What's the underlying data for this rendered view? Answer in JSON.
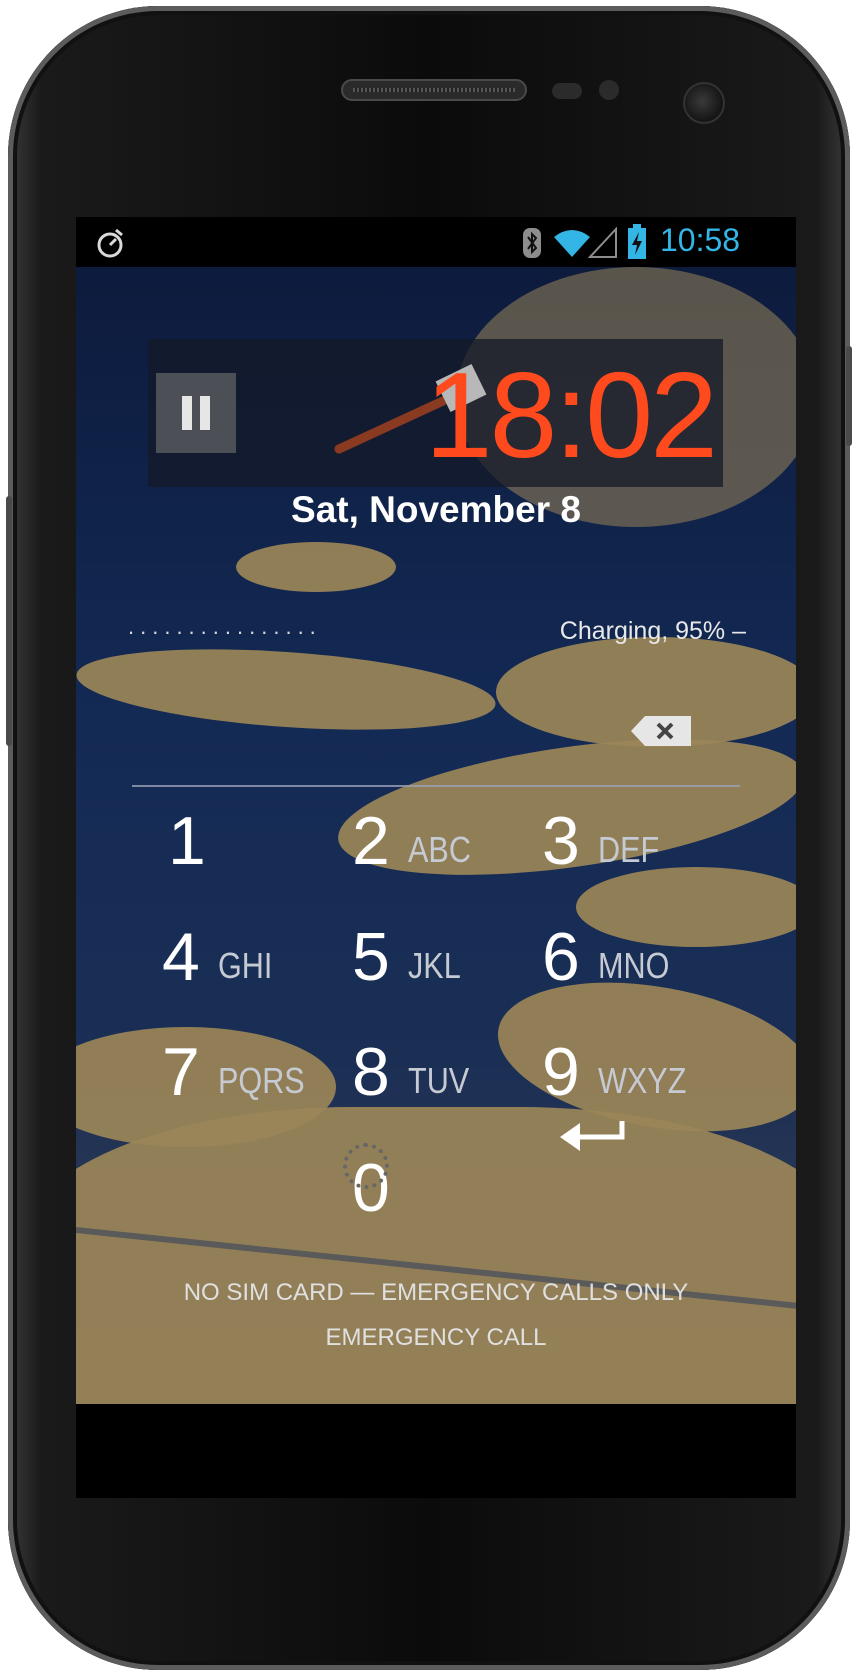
{
  "status_bar": {
    "time": "10:58",
    "left_icons": [
      "stopwatch-icon"
    ],
    "right_icons": [
      "bluetooth-icon",
      "wifi-icon",
      "signal-icon",
      "battery-charging-icon"
    ],
    "time_color": "#33b5e5"
  },
  "lockscreen": {
    "timer": "18:02",
    "timer_color": "#ff4a1e",
    "date": "Sat, November 8",
    "password_dots": "................",
    "charging": "Charging, 95% –",
    "keypad": [
      {
        "digit": "1",
        "letters": ""
      },
      {
        "digit": "2",
        "letters": "ABC"
      },
      {
        "digit": "3",
        "letters": "DEF"
      },
      {
        "digit": "4",
        "letters": "GHI"
      },
      {
        "digit": "5",
        "letters": "JKL"
      },
      {
        "digit": "6",
        "letters": "MNO"
      },
      {
        "digit": "7",
        "letters": "PQRS"
      },
      {
        "digit": "8",
        "letters": "TUV"
      },
      {
        "digit": "9",
        "letters": "WXYZ"
      },
      {
        "digit": "0",
        "letters": ""
      }
    ],
    "enter_icon": "enter-arrow-icon",
    "backspace_icon": "backspace-icon",
    "sim_status": "NO SIM CARD — EMERGENCY CALLS ONLY",
    "emergency_call": "EMERGENCY CALL"
  }
}
